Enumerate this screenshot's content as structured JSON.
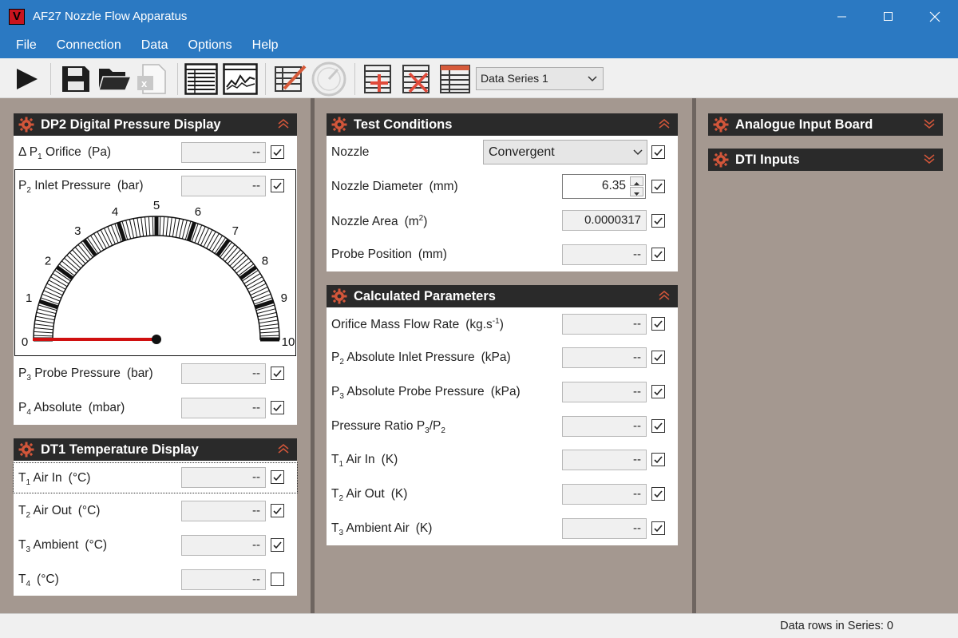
{
  "window": {
    "logo": "V",
    "title": "AF27 Nozzle Flow Apparatus"
  },
  "menu": [
    "File",
    "Connection",
    "Data",
    "Options",
    "Help"
  ],
  "toolbar": {
    "icons": [
      "play-icon",
      "save-icon",
      "open-folder-icon",
      "export-excel-icon",
      "table-view-icon",
      "chart-view-icon",
      "edit-series-icon",
      "gauge-settings-icon",
      "add-series-icon",
      "delete-series-icon",
      "series-table-icon"
    ],
    "series_selected": "Data Series 1"
  },
  "dp2": {
    "title": "DP2 Digital Pressure Display",
    "rows": [
      {
        "sym": "Δ P",
        "sub": "1",
        "label": " Orifice",
        "unit": "(Pa)",
        "value": "--",
        "checked": true
      },
      {
        "sym": "P",
        "sub": "2",
        "label": " Inlet Pressure",
        "unit": "(bar)",
        "value": "--",
        "checked": true
      },
      {
        "sym": "P",
        "sub": "3",
        "label": " Probe Pressure",
        "unit": "(bar)",
        "value": "--",
        "checked": true
      },
      {
        "sym": "P",
        "sub": "4",
        "label": " Absolute",
        "unit": "(mbar)",
        "value": "--",
        "checked": true
      }
    ],
    "gauge": {
      "min": 0,
      "max": 10,
      "value": 0,
      "tick_labels": [
        "0",
        "1",
        "2",
        "3",
        "4",
        "5",
        "6",
        "7",
        "8",
        "9",
        "10"
      ],
      "needle_color": "#d01010"
    }
  },
  "dt1": {
    "title": "DT1 Temperature Display",
    "rows": [
      {
        "sym": "T",
        "sub": "1",
        "label": " Air In",
        "unit": "(°C)",
        "value": "--",
        "checked": true
      },
      {
        "sym": "T",
        "sub": "2",
        "label": " Air Out",
        "unit": "(°C)",
        "value": "--",
        "checked": true
      },
      {
        "sym": "T",
        "sub": "3",
        "label": " Ambient",
        "unit": "(°C)",
        "value": "--",
        "checked": true
      },
      {
        "sym": "T",
        "sub": "4",
        "label": "",
        "unit": "(°C)",
        "value": "--",
        "checked": false
      }
    ]
  },
  "test_conditions": {
    "title": "Test Conditions",
    "nozzle_label": "Nozzle",
    "nozzle_value": "Convergent",
    "diameter_label": "Nozzle Diameter",
    "diameter_unit": "(mm)",
    "diameter_value": "6.35",
    "area_label": "Nozzle Area",
    "area_unit_base": "(m",
    "area_unit_sup": "2",
    "area_unit_end": ")",
    "area_value": "0.0000317",
    "probe_label": "Probe Position",
    "probe_unit": "(mm)",
    "probe_value": "--"
  },
  "calculated": {
    "title": "Calculated Parameters",
    "rows": [
      {
        "pre": "Orifice Mass Flow Rate",
        "sub": "",
        "post": "",
        "unit": "(kg.s",
        "unit_sup": "-1",
        "unit_end": ")",
        "value": "--"
      },
      {
        "pre": "P",
        "sub": "2",
        "post": " Absolute Inlet Pressure",
        "unit": "(kPa)",
        "unit_sup": "",
        "unit_end": "",
        "value": "--"
      },
      {
        "pre": "P",
        "sub": "3",
        "post": " Absolute Probe Pressure",
        "unit": "(kPa)",
        "unit_sup": "",
        "unit_end": "",
        "value": "--"
      },
      {
        "pre": "Pressure Ratio P",
        "sub": "3",
        "post": "/P",
        "sub2": "2",
        "unit": "",
        "unit_sup": "",
        "unit_end": "",
        "value": "--"
      },
      {
        "pre": "T",
        "sub": "1",
        "post": " Air In",
        "unit": "(K)",
        "unit_sup": "",
        "unit_end": "",
        "value": "--"
      },
      {
        "pre": "T",
        "sub": "2",
        "post": " Air Out",
        "unit": "(K)",
        "unit_sup": "",
        "unit_end": "",
        "value": "--"
      },
      {
        "pre": "T",
        "sub": "3",
        "post": " Ambient Air",
        "unit": "(K)",
        "unit_sup": "",
        "unit_end": "",
        "value": "--"
      }
    ]
  },
  "right_panels": [
    {
      "title": "Analogue Input Board"
    },
    {
      "title": "DTI Inputs"
    }
  ],
  "status": {
    "text": "Data rows in Series: 0"
  }
}
